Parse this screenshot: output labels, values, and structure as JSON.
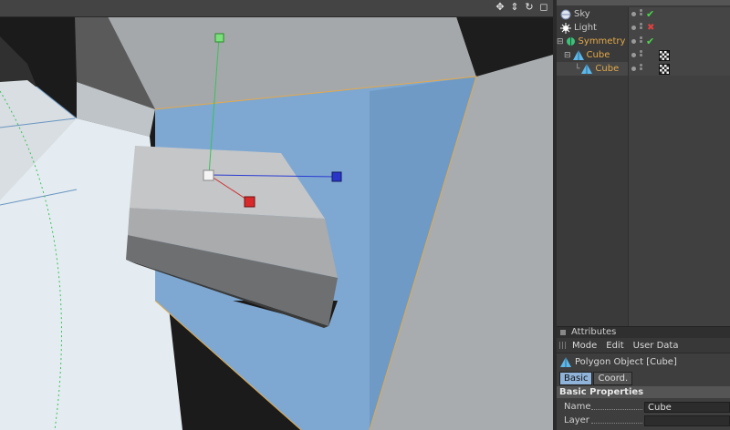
{
  "objects": [
    {
      "name": "Sky",
      "color": "#c8c8c8",
      "icon": "sky-icon",
      "tag": "check"
    },
    {
      "name": "Light",
      "color": "#c8c8c8",
      "icon": "light-icon",
      "tag": "cross"
    },
    {
      "name": "Symmetry",
      "color": "#e3a94a",
      "icon": "symmetry-icon",
      "tag": "check"
    },
    {
      "name": "Cube",
      "color": "#e3a94a",
      "icon": "polygon-icon",
      "tag": "checker"
    },
    {
      "name": "Cube",
      "color": "#e3a94a",
      "icon": "polygon-icon",
      "tag": "checker"
    }
  ],
  "attributes": {
    "header": "Attributes",
    "menu": [
      "Mode",
      "Edit",
      "User Data"
    ],
    "object_title": "Polygon Object [Cube]",
    "tabs": [
      "Basic",
      "Coord."
    ],
    "section": "Basic Properties",
    "fields": [
      {
        "label": "Name",
        "value": "Cube"
      },
      {
        "label": "Layer",
        "value": ""
      }
    ]
  },
  "viewport": {
    "nav_icons": [
      "move-icon",
      "move-down-icon",
      "rotate-icon",
      "maximize-icon"
    ]
  },
  "colors": {
    "accent_blue": "#8fb3d9",
    "selection_orange": "#e3a94a",
    "check_green": "#4cd44c",
    "cross_red": "#e04040"
  }
}
